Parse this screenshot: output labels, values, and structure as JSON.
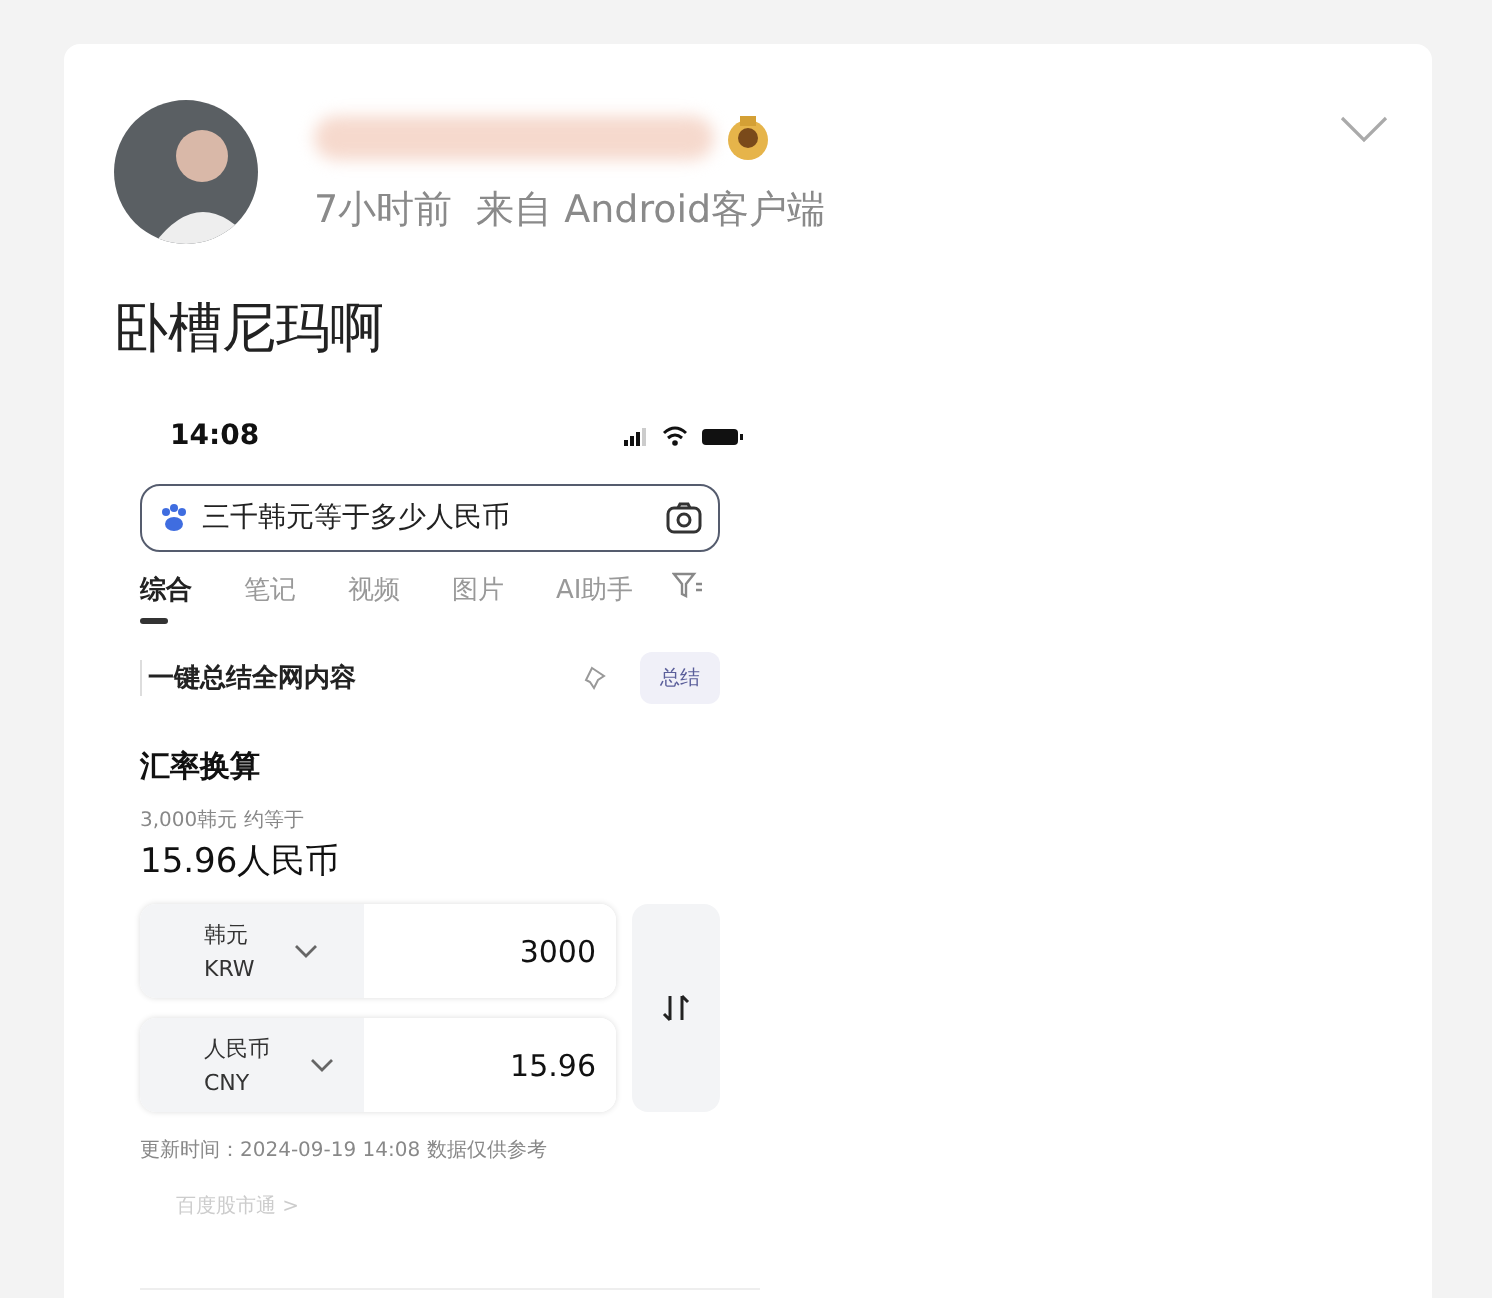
{
  "post": {
    "time": "7小时前",
    "source": "来自 Android客户端",
    "text": "卧槽尼玛啊"
  },
  "screenshot": {
    "status_time": "14:08",
    "search_query": "三千韩元等于多少人民币",
    "tabs": [
      {
        "label": "综合",
        "selected": true
      },
      {
        "label": "笔记",
        "selected": false
      },
      {
        "label": "视频",
        "selected": false
      },
      {
        "label": "图片",
        "selected": false
      },
      {
        "label": "AI助手",
        "selected": false
      }
    ],
    "summary": {
      "text": "一键总结全网内容",
      "button": "总结"
    },
    "converter": {
      "title": "汇率换算",
      "caption": "3,000韩元 约等于",
      "result": "15.96人民币",
      "rows": [
        {
          "currency": "韩元",
          "code": "KRW",
          "amount": "3000"
        },
        {
          "currency": "人民币",
          "code": "CNY",
          "amount": "15.96"
        }
      ],
      "updated": "更新时间：2024-09-19 14:08 数据仅供参考",
      "link": "百度股市通 >"
    }
  }
}
